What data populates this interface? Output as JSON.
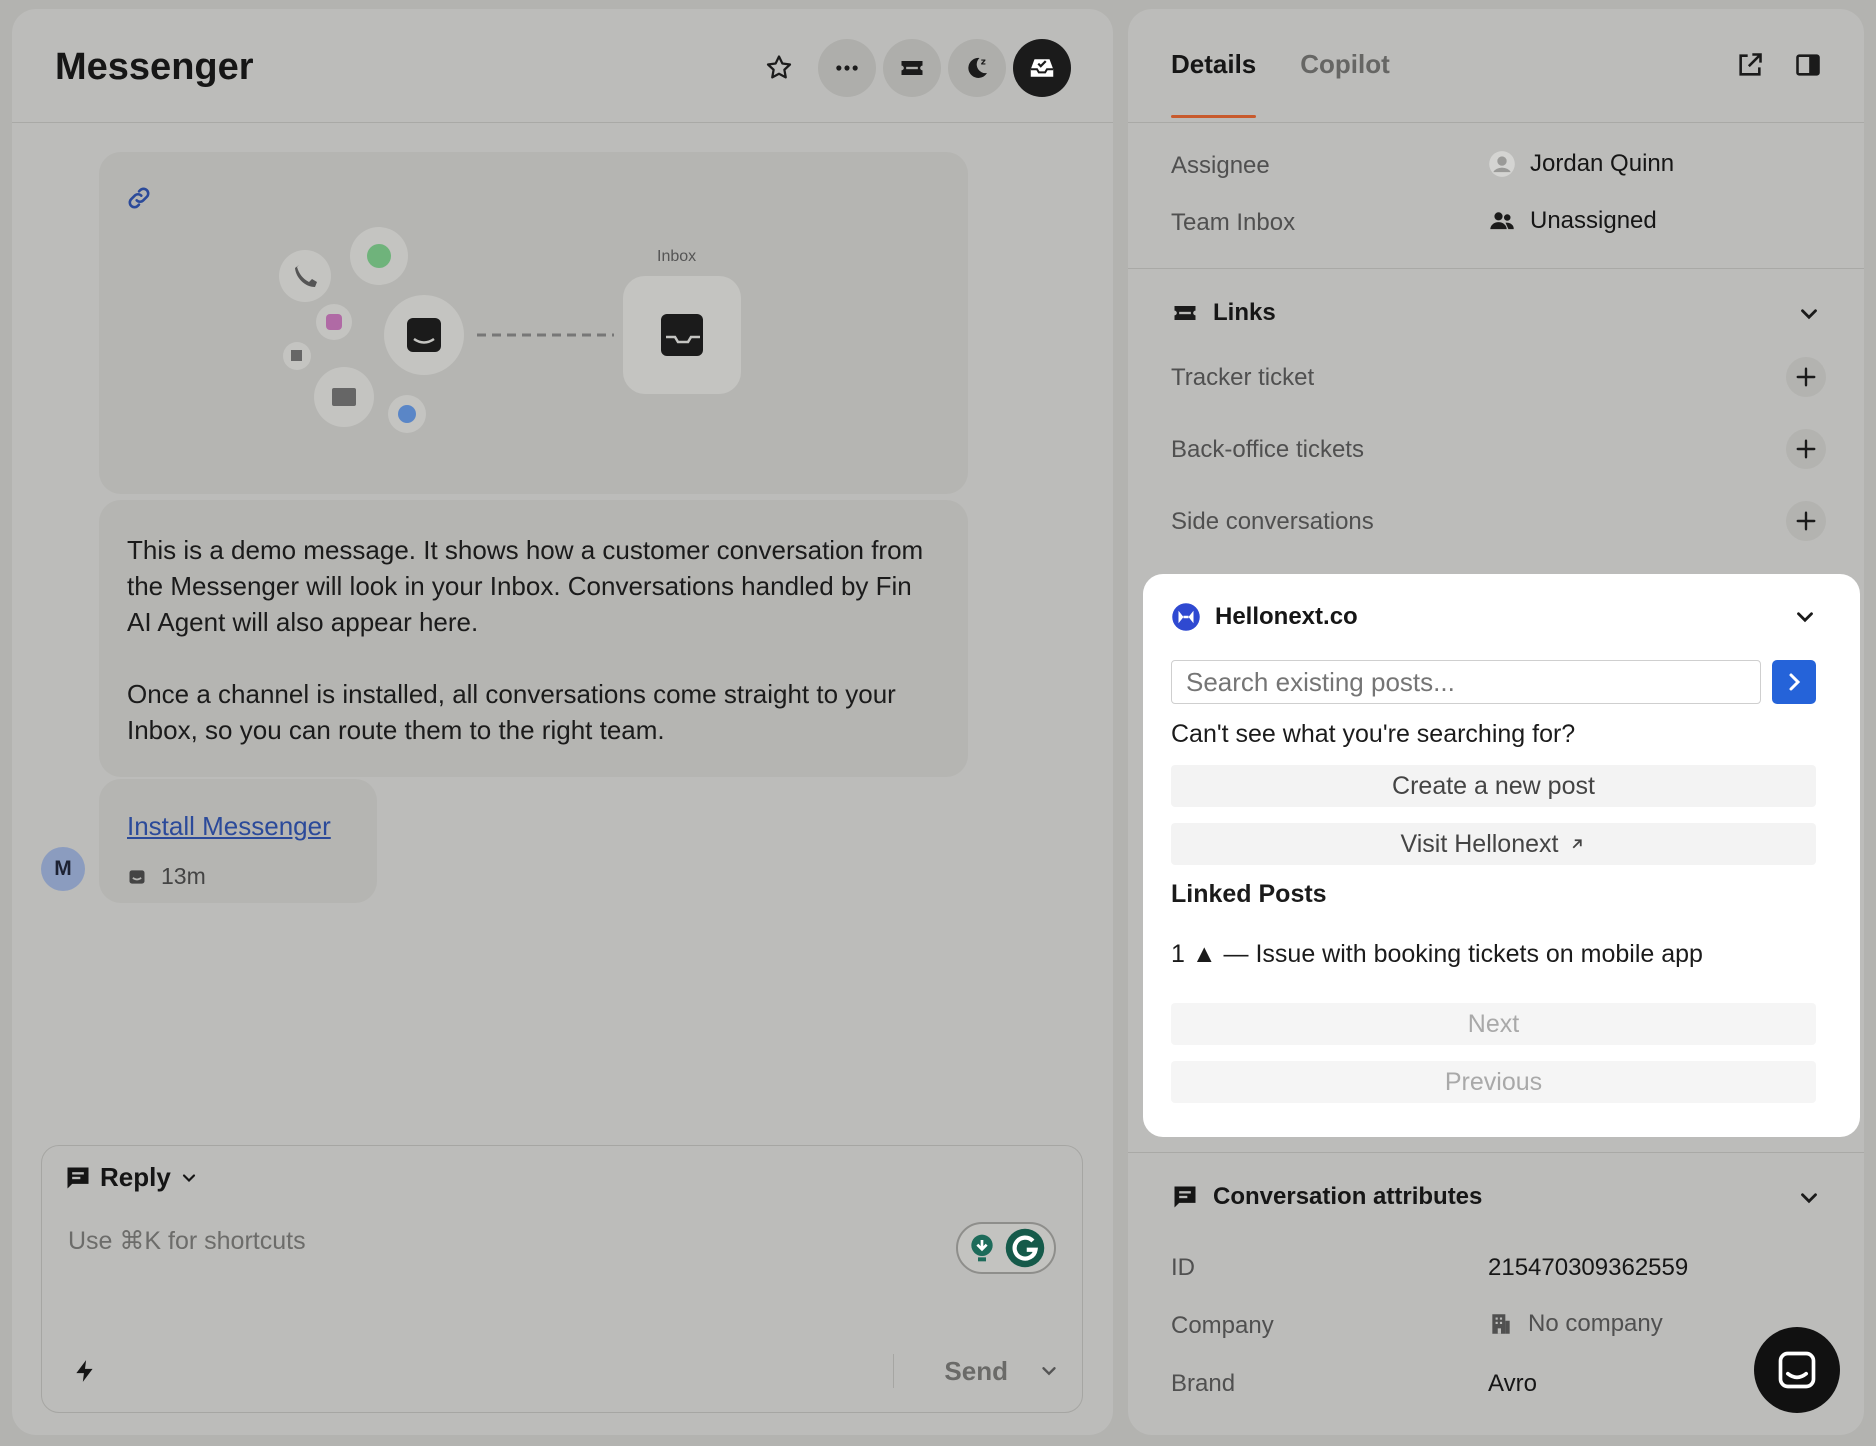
{
  "conversation": {
    "title": "Messenger",
    "diagram_label": "Inbox",
    "message_paragraphs": [
      "This is a demo message. It shows how a customer conversation from the Messenger will look in your Inbox. Conversations handled by Fin AI Agent will also appear here.",
      "Once a channel is installed, all conversations come straight to your Inbox, so you can route them to the right team."
    ],
    "install_link": "Install Messenger",
    "timestamp": "13m",
    "avatar_initial": "M"
  },
  "composer": {
    "mode_label": "Reply",
    "placeholder": "Use ⌘K for shortcuts",
    "send_label": "Send"
  },
  "details": {
    "tabs": [
      "Details",
      "Copilot"
    ],
    "assignee_label": "Assignee",
    "assignee_value": "Jordan Quinn",
    "team_inbox_label": "Team Inbox",
    "team_inbox_value": "Unassigned",
    "links_title": "Links",
    "links_items": [
      "Tracker ticket",
      "Back-office tickets",
      "Side conversations"
    ]
  },
  "hellonext": {
    "title": "Hellonext.co",
    "search_placeholder": "Search existing posts...",
    "question": "Can't see what you're searching for?",
    "create_button": "Create a new post",
    "visit_button": "Visit Hellonext",
    "linked_title": "Linked Posts",
    "linked_post": "1 ▲ — Issue with booking tickets on mobile app",
    "next_button": "Next",
    "previous_button": "Previous"
  },
  "attributes": {
    "title": "Conversation attributes",
    "id_label": "ID",
    "id_value": "215470309362559",
    "company_label": "Company",
    "company_value": "No company",
    "brand_label": "Brand",
    "brand_value": "Avro"
  },
  "colors": {
    "accent_tab": "#c85a2d",
    "hellonext_blue": "#2563d9",
    "link": "#2b4a9a"
  }
}
